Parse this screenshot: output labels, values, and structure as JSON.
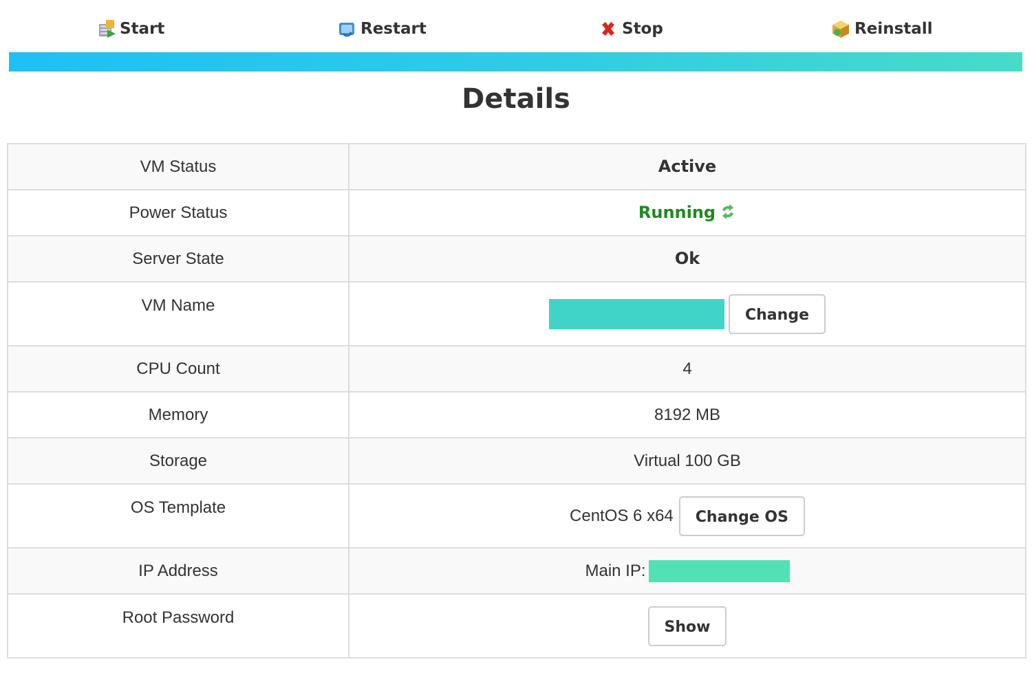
{
  "actions": {
    "start_label": "Start",
    "restart_label": "Restart",
    "stop_label": "Stop",
    "reinstall_label": "Reinstall"
  },
  "colors": {
    "accent_gradient_start": "#1ec0f5",
    "accent_gradient_end": "#48dbc8",
    "running_green": "#1e8a1e",
    "row_stripe": "#f9f9f9",
    "border": "#dddddd"
  },
  "details": {
    "title": "Details",
    "vm_status": {
      "label": "VM Status",
      "value": "Active"
    },
    "power_status": {
      "label": "Power Status",
      "value": "Running",
      "icon": "refresh-arrows-icon"
    },
    "server_state": {
      "label": "Server State",
      "value": "Ok"
    },
    "vm_name": {
      "label": "VM Name",
      "button_label": "Change"
    },
    "cpu_count": {
      "label": "CPU Count",
      "value": "4"
    },
    "memory": {
      "label": "Memory",
      "value": "8192 MB"
    },
    "storage": {
      "label": "Storage",
      "value": "Virtual 100 GB"
    },
    "os_template": {
      "label": "OS Template",
      "value": "CentOS 6 x64",
      "button_label": "Change OS"
    },
    "ip_address": {
      "label": "IP Address",
      "prefix": "Main IP:"
    },
    "root_password": {
      "label": "Root Password",
      "button_label": "Show"
    }
  }
}
